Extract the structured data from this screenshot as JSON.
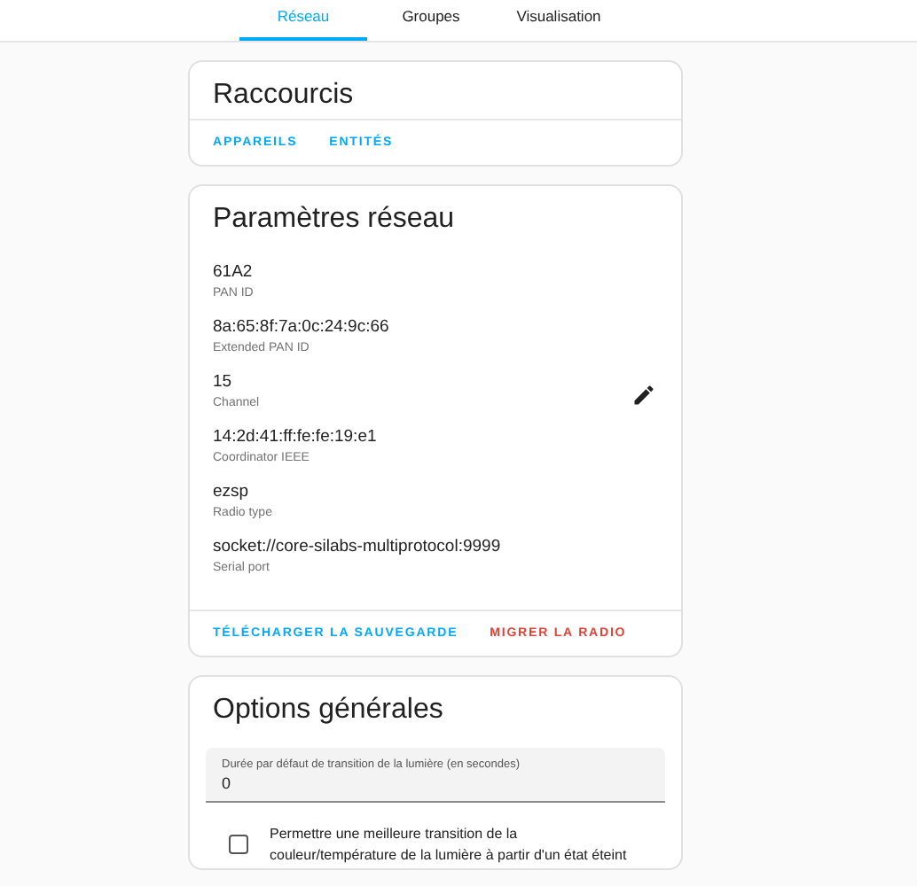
{
  "tabs": [
    {
      "label": "Réseau",
      "selected": true
    },
    {
      "label": "Groupes",
      "selected": false
    },
    {
      "label": "Visualisation",
      "selected": false
    }
  ],
  "shortcuts": {
    "title": "Raccourcis",
    "actions": [
      {
        "label": "APPAREILS",
        "kind": "primary"
      },
      {
        "label": "ENTITÉS",
        "kind": "primary"
      }
    ]
  },
  "network": {
    "title": "Paramètres réseau",
    "settings": [
      {
        "value": "61A2",
        "label": "PAN ID"
      },
      {
        "value": "8a:65:8f:7a:0c:24:9c:66",
        "label": "Extended PAN ID"
      },
      {
        "value": "15",
        "label": "Channel",
        "editable": true
      },
      {
        "value": "14:2d:41:ff:fe:fe:19:e1",
        "label": "Coordinator IEEE"
      },
      {
        "value": "ezsp",
        "label": "Radio type"
      },
      {
        "value": "socket://core-silabs-multiprotocol:9999",
        "label": "Serial port"
      }
    ],
    "actions": [
      {
        "label": "TÉLÉCHARGER LA SAUVEGARDE",
        "kind": "primary"
      },
      {
        "label": "MIGRER LA RADIO",
        "kind": "danger"
      }
    ]
  },
  "options": {
    "title": "Options générales",
    "field": {
      "label": "Durée par défaut de transition de la lumière (en secondes)",
      "value": "0"
    },
    "checkbox": {
      "label": "Permettre une meilleure transition de la couleur/température de la lumière à partir d'un état éteint",
      "checked": false
    }
  }
}
